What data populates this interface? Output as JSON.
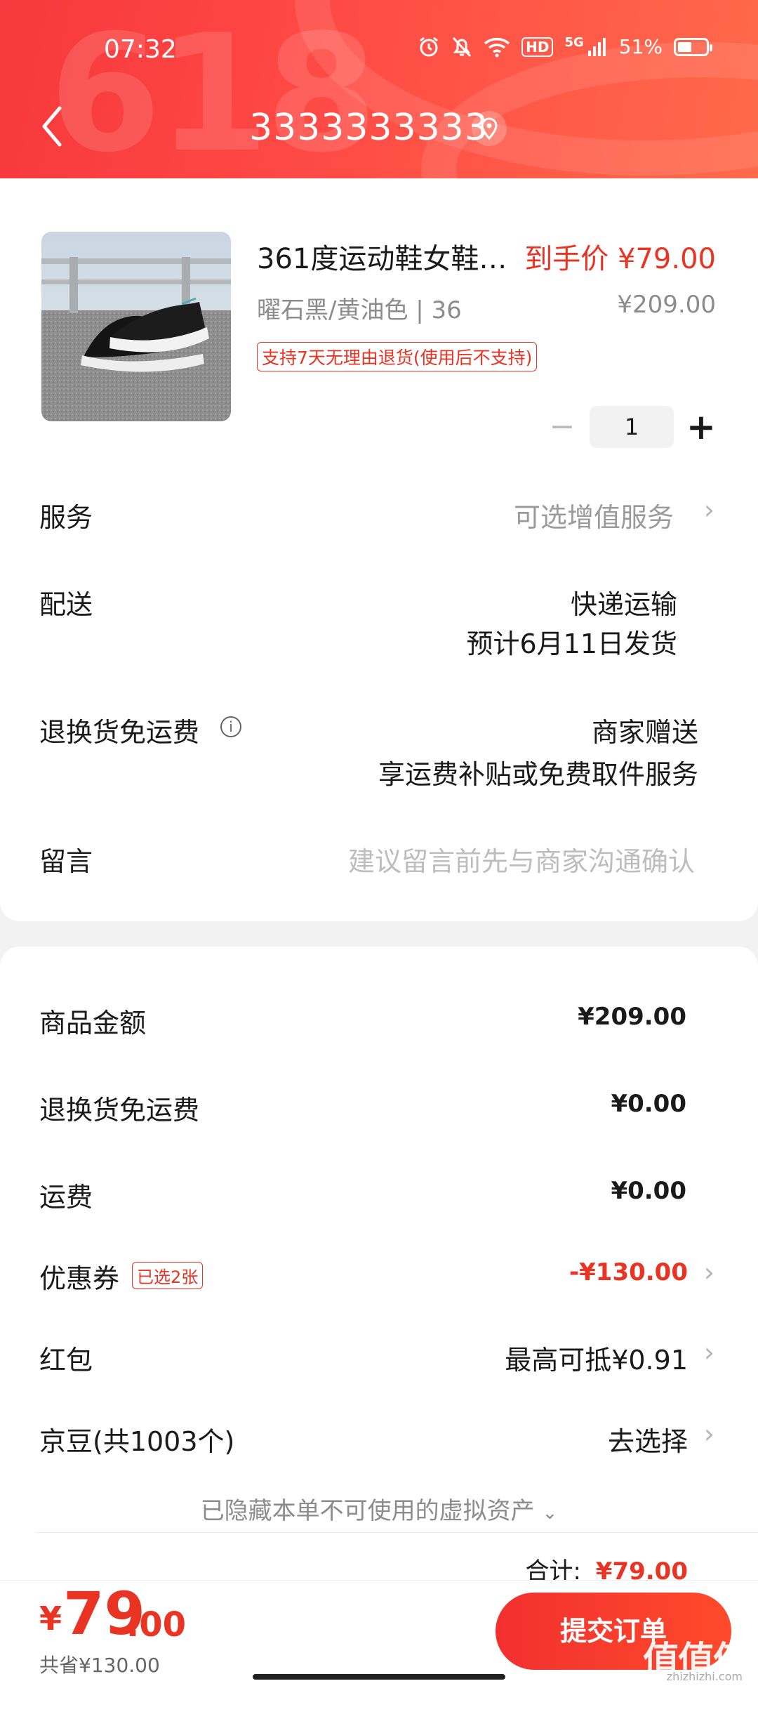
{
  "status_bar": {
    "time": "07:32",
    "hd": "HD",
    "network": "5G",
    "battery": "51%",
    "battery_level": 0.51
  },
  "header": {
    "title": "3333333333",
    "deco_text": "618"
  },
  "product": {
    "name": "361度运动鞋女鞋…",
    "final_price": "到手价 ¥79.00",
    "spec": "曜石黑/黄油色 | 36",
    "original_price": "¥209.00",
    "return_policy": "支持7天无理由退货(使用后不支持)",
    "quantity": "1",
    "minus": "−",
    "plus": "+"
  },
  "order_rows": {
    "service": {
      "label": "服务",
      "value": "可选增值服务"
    },
    "delivery": {
      "label": "配送",
      "method": "快递运输",
      "estimate": "预计6月11日发货"
    },
    "return_shipping": {
      "label": "退换货免运费",
      "value1": "商家赠送",
      "value2": "享运费补贴或免费取件服务"
    },
    "message": {
      "label": "留言",
      "placeholder": "建议留言前先与商家沟通确认"
    }
  },
  "summary": {
    "goods_amount": {
      "label": "商品金额",
      "value": "¥209.00"
    },
    "return_fee": {
      "label": "退换货免运费",
      "value": "¥0.00"
    },
    "shipping": {
      "label": "运费",
      "value": "¥0.00"
    },
    "coupon": {
      "label": "优惠券",
      "tag": "已选2张",
      "value": "-¥130.00"
    },
    "red_packet": {
      "label": "红包",
      "value": "最高可抵¥0.91"
    },
    "jd_beans": {
      "label": "京豆(共1003个)",
      "value": "去选择"
    },
    "hidden_assets": "已隐藏本单不可使用的虚拟资产",
    "total_label": "合计:",
    "total_value": "¥79.00"
  },
  "bottom": {
    "yen": "¥",
    "price_int": "79",
    "price_dec": ".00",
    "saved": "共省¥130.00",
    "submit": "提交订单",
    "watermark": "值值值",
    "watermark_sub": "zhizhizhi.com"
  },
  "colors": {
    "accent": "#e93323",
    "header": "#f7383c"
  }
}
